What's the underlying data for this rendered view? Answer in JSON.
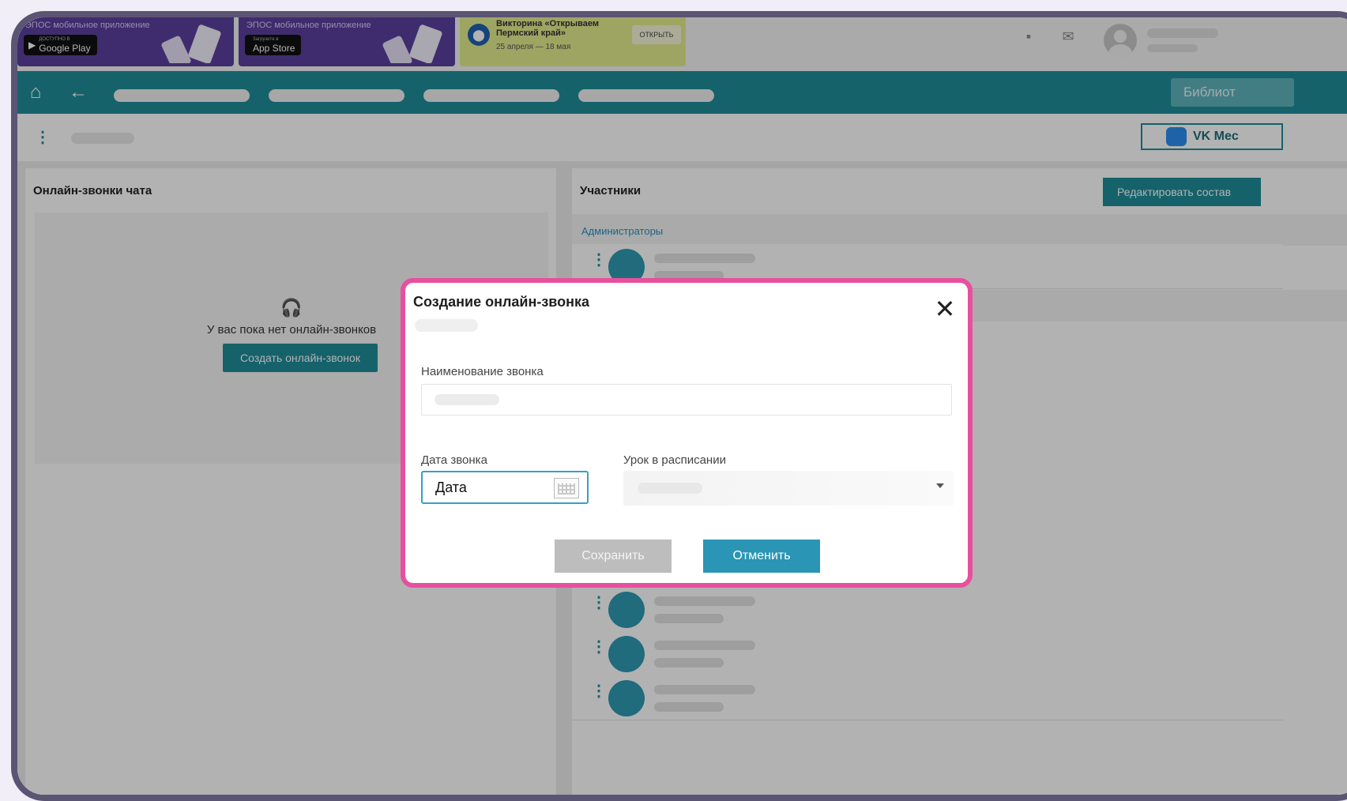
{
  "banners": {
    "google": {
      "text": "ЭПОС мобильное приложение",
      "store_small": "ДОСТУПНО В",
      "store": "Google Play"
    },
    "apple": {
      "text": "ЭПОС мобильное приложение",
      "store_small": "Загрузите в",
      "store": "App Store"
    },
    "quiz": {
      "title": "Викторина «Открываем Пермский край»",
      "date": "25 апреля — 18 мая",
      "button": "ОТКРЫТЬ"
    }
  },
  "nav": {
    "library_label": "Библиот"
  },
  "subbar": {
    "vk_label": "VK Mec"
  },
  "left_panel": {
    "title": "Онлайн-звонки чата",
    "empty_text": "У вас пока нет онлайн-звонков",
    "create_button": "Создать онлайн-звонок"
  },
  "right_panel": {
    "title": "Участники",
    "edit_button": "Редактировать состав",
    "admins_label": "Администраторы"
  },
  "modal": {
    "title": "Создание онлайн-звонка",
    "name_label": "Наименование звонка",
    "date_label": "Дата звонка",
    "date_placeholder": "Дата",
    "lesson_label": "Урок в расписании",
    "save_button": "Сохранить",
    "cancel_button": "Отменить"
  },
  "colors": {
    "teal": "#1f8d9a",
    "modal_border": "#e94f9e",
    "cancel_blue": "#2a95b4"
  }
}
